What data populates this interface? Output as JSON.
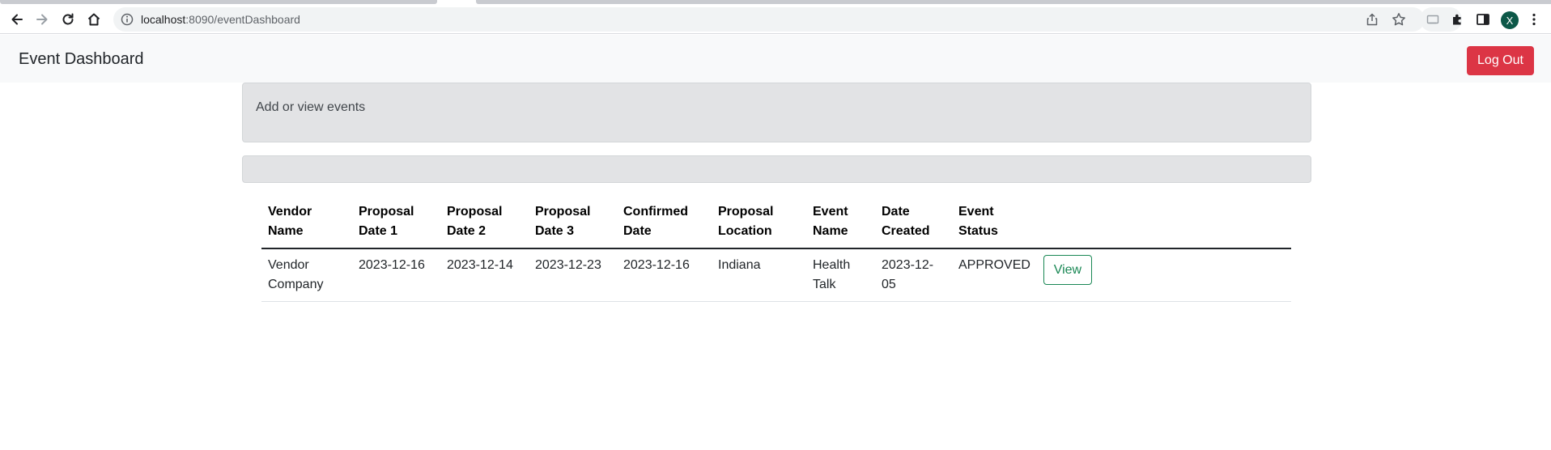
{
  "browser": {
    "url_host": "localhost",
    "url_rest": ":8090/eventDashboard",
    "profile_initial": "X"
  },
  "navbar": {
    "brand": "Event Dashboard",
    "logout_label": "Log Out"
  },
  "intro_panel": {
    "text": "Add or view events"
  },
  "events_table": {
    "headers": {
      "vendor": [
        "Vendor",
        "Name"
      ],
      "proposal_date_1": [
        "Proposal",
        "Date 1"
      ],
      "proposal_date_2": [
        "Proposal",
        "Date 2"
      ],
      "proposal_date_3": [
        "Proposal",
        "Date 3"
      ],
      "confirmed_date": [
        "Confirmed",
        "Date"
      ],
      "proposal_location": [
        "Proposal",
        "Location"
      ],
      "event_name": [
        "Event",
        "Name"
      ],
      "date_created": [
        "Date",
        "Created"
      ],
      "event_status": [
        "Event",
        "Status"
      ]
    },
    "rows": [
      {
        "vendor_name": "Vendor Company",
        "proposal_date_1": "2023-12-16",
        "proposal_date_2": "2023-12-14",
        "proposal_date_3": "2023-12-23",
        "confirmed_date": "2023-12-16",
        "proposal_location": "Indiana",
        "event_name": "Health Talk",
        "date_created": "2023-12-05",
        "event_status": "APPROVED",
        "action_label": "View"
      }
    ]
  },
  "colors": {
    "logout_bg": "#dc3545",
    "view_outline": "#198754",
    "panel_bg": "#e2e3e5",
    "navbar_bg": "#f8f9fa"
  }
}
